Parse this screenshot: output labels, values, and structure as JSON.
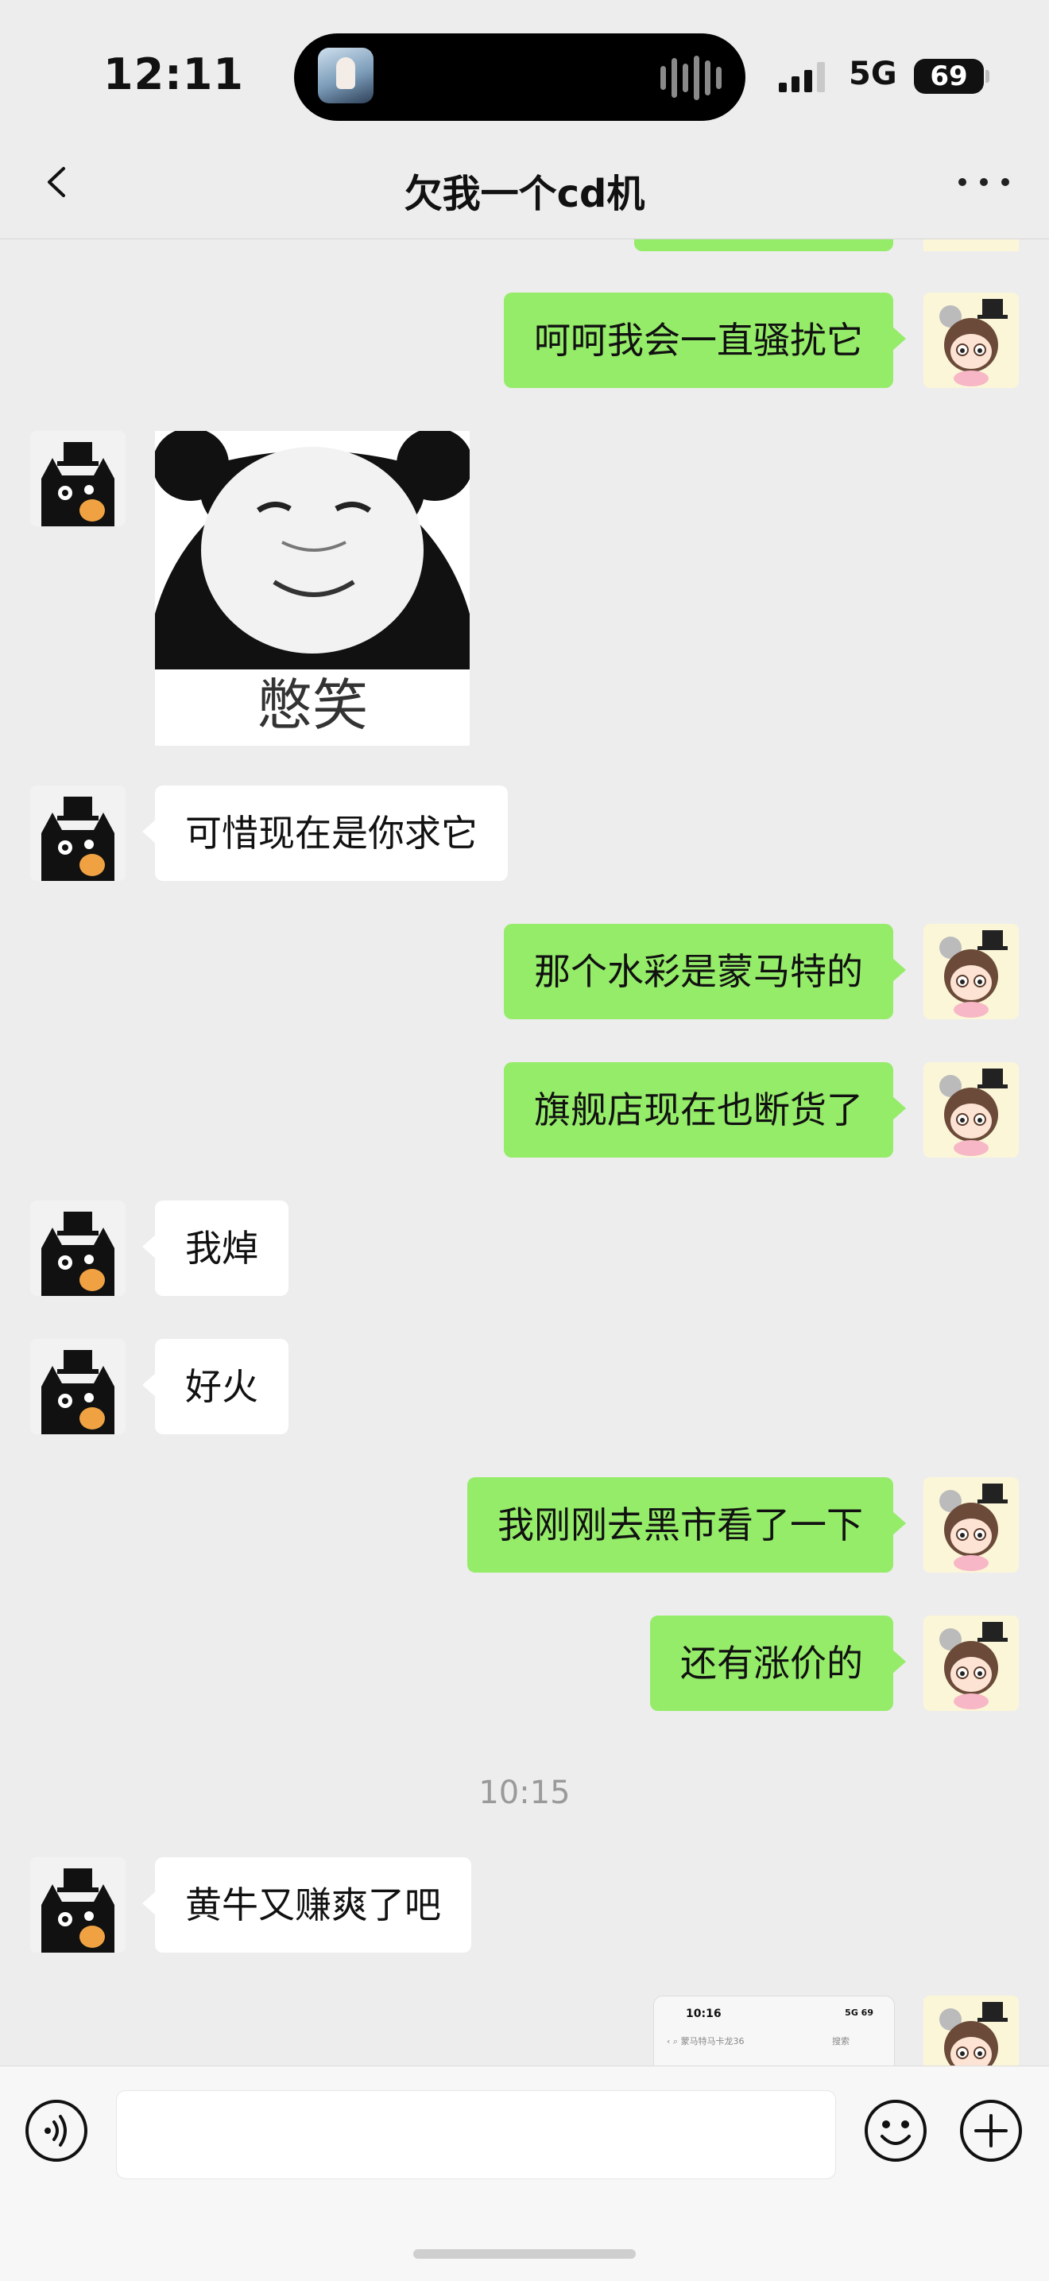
{
  "status_bar": {
    "time": "12:11",
    "network": "5G",
    "battery": "69"
  },
  "header": {
    "title": "欠我一个cd机"
  },
  "messages": [
    {
      "side": "right",
      "text": "呵呵我会一直骚扰它"
    },
    {
      "side": "left",
      "sticker_caption": "憋笑"
    },
    {
      "side": "left",
      "text": "可惜现在是你求它"
    },
    {
      "side": "right",
      "text": "那个水彩是蒙马特的"
    },
    {
      "side": "right",
      "text": "旗舰店现在也断货了"
    },
    {
      "side": "left",
      "text": "我焯"
    },
    {
      "side": "left",
      "text": "好火"
    },
    {
      "side": "right",
      "text": "我刚刚去黑市看了一下"
    },
    {
      "side": "right",
      "text": "还有涨价的"
    },
    {
      "side": "left",
      "text": "黄牛又赚爽了吧"
    }
  ],
  "timestamp": "10:15",
  "screenshot_preview": {
    "time": "10:16",
    "battery": "5G 69",
    "search_text": "蒙马特马卡龙36",
    "search_button": "搜索"
  },
  "colors": {
    "background": "#ededed",
    "sent_bubble": "#95ec69",
    "received_bubble": "#ffffff"
  }
}
